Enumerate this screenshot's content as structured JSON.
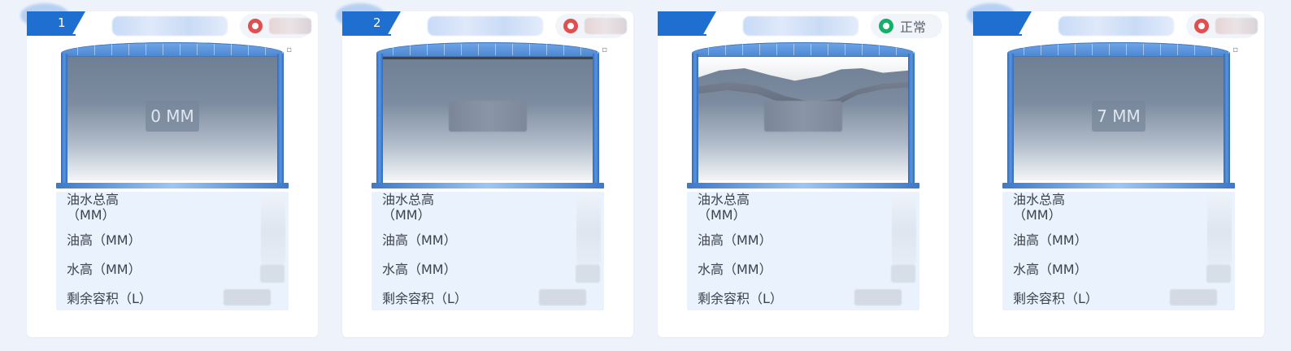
{
  "labels": {
    "total_height": "油水总高",
    "total_height_unit": "（MM）",
    "oil_height": "油高（MM）",
    "water_height": "水高（MM）",
    "remaining_volume": "剩余容积（L）"
  },
  "tanks": [
    {
      "number": "1",
      "status_label": "",
      "status_color": "#e05050",
      "level_label": "0 MM"
    },
    {
      "number": "2",
      "status_label": "",
      "status_color": "#e05050",
      "level_label": ""
    },
    {
      "number": "",
      "status_label": "正常",
      "status_color": "#14b06a",
      "level_label": ""
    },
    {
      "number": "",
      "status_label": "",
      "status_color": "#e05050",
      "level_label": "7 MM"
    }
  ]
}
